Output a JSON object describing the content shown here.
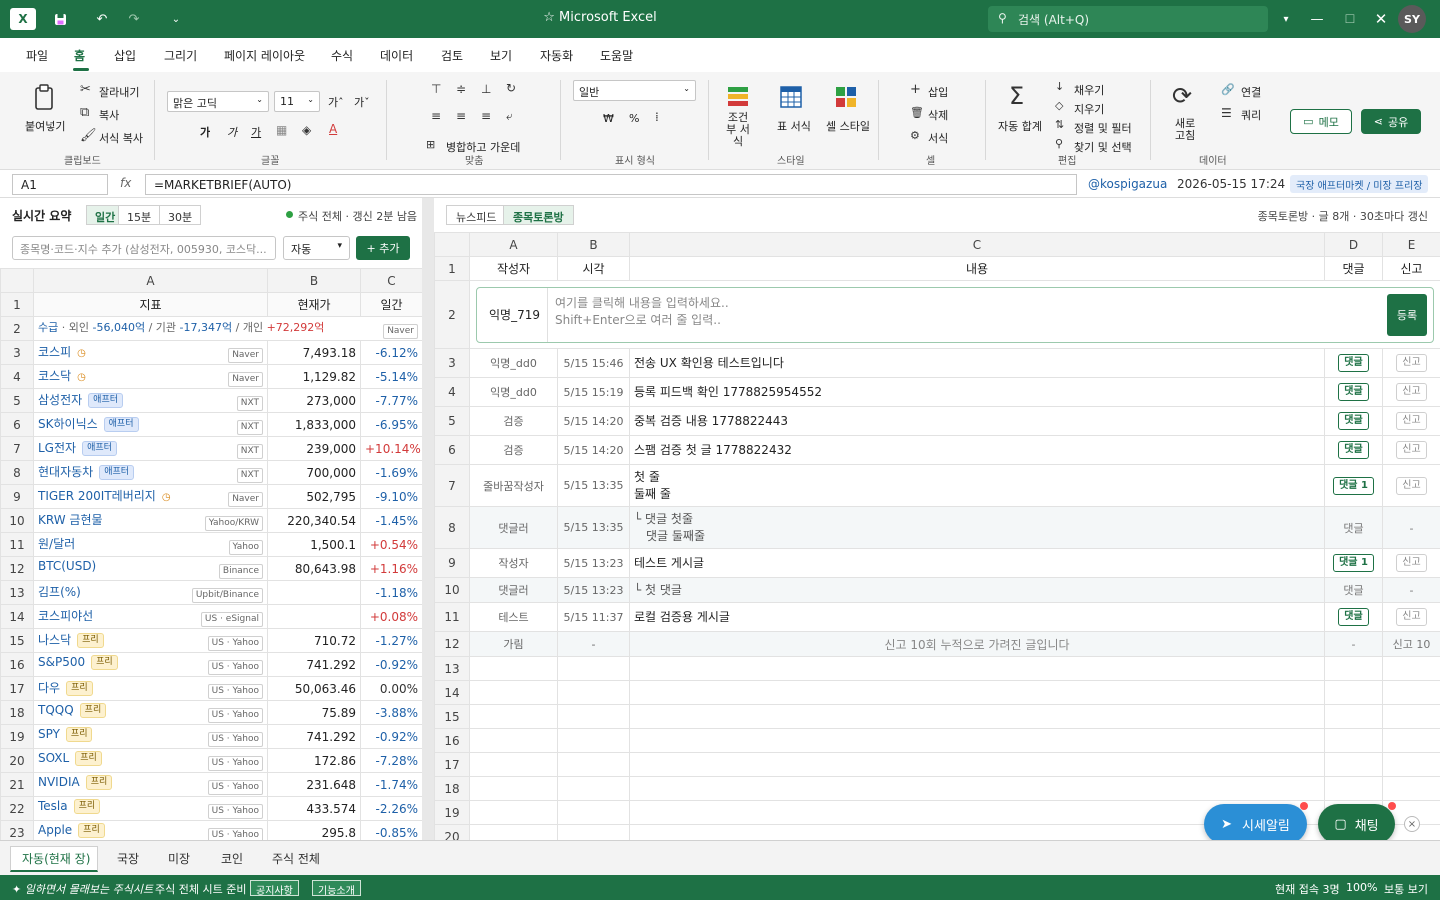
{
  "title_bar": {
    "app_title": "Microsoft Excel",
    "search_placeholder": "검색 (Alt+Q)",
    "avatar_initials": "SY",
    "icons": [
      "excel-logo-icon",
      "save-icon",
      "undo-icon",
      "redo-icon",
      "customize-icon",
      "star-icon",
      "search-icon",
      "ribbon-toggle-icon",
      "minimize-icon",
      "maximize-icon",
      "close-icon"
    ]
  },
  "menu": {
    "items": [
      "파일",
      "홈",
      "삽입",
      "그리기",
      "페이지 레이아웃",
      "수식",
      "데이터",
      "검토",
      "보기",
      "자동화",
      "도움말"
    ],
    "active": "홈"
  },
  "ribbon": {
    "clipboard": {
      "paste": "붙여넣기",
      "cut": "잘라내기",
      "copy": "복사",
      "format_copy": "서식 복사",
      "group": "클립보드"
    },
    "font": {
      "name": "맑은 고딕",
      "size": "11",
      "grow": "가ˆ",
      "shrink": "가ˇ",
      "bold": "가",
      "italic": "가",
      "underline": "가",
      "group": "글꼴"
    },
    "align": {
      "merge": "병합하고 가운데",
      "group": "맞춤"
    },
    "number": {
      "format": "일반",
      "currency": "₩",
      "percent": "%",
      "group": "표시 형식"
    },
    "style": {
      "conditional": "조건부 서식",
      "table": "표 서식",
      "cell_style": "셀 스타일",
      "group": "스타일"
    },
    "cells": {
      "insert": "삽입",
      "delete": "삭제",
      "format": "서식",
      "group": "셀"
    },
    "edit": {
      "sum": "자동 합계",
      "fill": "채우기",
      "clear": "지우기",
      "sort": "정렬 및 필터",
      "find": "찾기 및 선택",
      "group": "편집"
    },
    "data": {
      "refresh": "새로 고침",
      "connect": "연결",
      "query": "쿼리",
      "group": "데이터"
    },
    "memo": "메모",
    "share": "공유"
  },
  "formula_bar": {
    "cell": "A1",
    "fx": "fx",
    "formula": "=MARKETBRIEF(AUTO)",
    "handle": "@kospigazua",
    "datetime": "2026-05-15 17:24",
    "badge": "국장 애프터마켓 / 미장 프리장"
  },
  "left": {
    "title": "실시간 요약",
    "ranges": [
      "일간",
      "15분",
      "30분"
    ],
    "active_range": "일간",
    "status": "주식 전체 · 갱신 2분 남음",
    "search_placeholder": "종목명·코드·지수 추가 (삼성전자, 005930, 코스닥...",
    "mode": "자동",
    "add_button": "+ 추가",
    "col_letters": [
      "A",
      "B",
      "C"
    ],
    "headers": [
      "지표",
      "현재가",
      "일간"
    ],
    "supply": {
      "label": "수급",
      "foreign_label": "· 외인",
      "foreign": "-56,040억",
      "inst_label": "/ 기관",
      "inst": "-17,347억",
      "indiv_label": "/ 개인",
      "indiv": "+72,292억",
      "source": "Naver"
    },
    "rows": [
      {
        "num": "3",
        "name": "코스피",
        "tag": "",
        "clock": true,
        "source": "Naver",
        "price": "7,493.18",
        "change": "-6.12%",
        "dir": "neg"
      },
      {
        "num": "4",
        "name": "코스닥",
        "tag": "",
        "clock": true,
        "source": "Naver",
        "price": "1,129.82",
        "change": "-5.14%",
        "dir": "neg"
      },
      {
        "num": "5",
        "name": "삼성전자",
        "tag": "애프터",
        "clock": false,
        "source": "NXT",
        "price": "273,000",
        "change": "-7.77%",
        "dir": "neg"
      },
      {
        "num": "6",
        "name": "SK하이닉스",
        "tag": "애프터",
        "clock": false,
        "source": "NXT",
        "price": "1,833,000",
        "change": "-6.95%",
        "dir": "neg"
      },
      {
        "num": "7",
        "name": "LG전자",
        "tag": "애프터",
        "clock": false,
        "source": "NXT",
        "price": "239,000",
        "change": "+10.14%",
        "dir": "pos"
      },
      {
        "num": "8",
        "name": "현대자동차",
        "tag": "애프터",
        "clock": false,
        "source": "NXT",
        "price": "700,000",
        "change": "-1.69%",
        "dir": "neg"
      },
      {
        "num": "9",
        "name": "TIGER 200IT레버리지",
        "tag": "",
        "clock": true,
        "source": "Naver",
        "price": "502,795",
        "change": "-9.10%",
        "dir": "neg"
      },
      {
        "num": "10",
        "name": "KRW 금현물",
        "tag": "",
        "clock": false,
        "source": "Yahoo/KRW",
        "price": "220,340.54",
        "change": "-1.45%",
        "dir": "neg"
      },
      {
        "num": "11",
        "name": "원/달러",
        "tag": "",
        "clock": false,
        "source": "Yahoo",
        "price": "1,500.1",
        "change": "+0.54%",
        "dir": "pos"
      },
      {
        "num": "12",
        "name": "BTC(USD)",
        "tag": "",
        "clock": false,
        "source": "Binance",
        "price": "80,643.98",
        "change": "+1.16%",
        "dir": "pos"
      },
      {
        "num": "13",
        "name": "김프(%)",
        "tag": "",
        "clock": false,
        "source": "Upbit/Binance",
        "price": "",
        "change": "-1.18%",
        "dir": "neg"
      },
      {
        "num": "14",
        "name": "코스피야선",
        "tag": "",
        "clock": false,
        "source": "US · eSignal",
        "price": "",
        "change": "+0.08%",
        "dir": "pos"
      },
      {
        "num": "15",
        "name": "나스닥",
        "tag": "프리",
        "clock": false,
        "source": "US · Yahoo",
        "price": "710.72",
        "change": "-1.27%",
        "dir": "neg"
      },
      {
        "num": "16",
        "name": "S&P500",
        "tag": "프리",
        "clock": false,
        "source": "US · Yahoo",
        "price": "741.292",
        "change": "-0.92%",
        "dir": "neg"
      },
      {
        "num": "17",
        "name": "다우",
        "tag": "프리",
        "clock": false,
        "source": "US · Yahoo",
        "price": "50,063.46",
        "change": "0.00%",
        "dir": "zero"
      },
      {
        "num": "18",
        "name": "TQQQ",
        "tag": "프리",
        "clock": false,
        "source": "US · Yahoo",
        "price": "75.89",
        "change": "-3.88%",
        "dir": "neg"
      },
      {
        "num": "19",
        "name": "SPY",
        "tag": "프리",
        "clock": false,
        "source": "US · Yahoo",
        "price": "741.292",
        "change": "-0.92%",
        "dir": "neg"
      },
      {
        "num": "20",
        "name": "SOXL",
        "tag": "프리",
        "clock": false,
        "source": "US · Yahoo",
        "price": "172.86",
        "change": "-7.28%",
        "dir": "neg"
      },
      {
        "num": "21",
        "name": "NVIDIA",
        "tag": "프리",
        "clock": false,
        "source": "US · Yahoo",
        "price": "231.648",
        "change": "-1.74%",
        "dir": "neg"
      },
      {
        "num": "22",
        "name": "Tesla",
        "tag": "프리",
        "clock": false,
        "source": "US · Yahoo",
        "price": "433.574",
        "change": "-2.26%",
        "dir": "neg"
      },
      {
        "num": "23",
        "name": "Apple",
        "tag": "프리",
        "clock": false,
        "source": "US · Yahoo",
        "price": "295.8",
        "change": "-0.85%",
        "dir": "neg"
      }
    ]
  },
  "right": {
    "tabs": [
      "뉴스피드",
      "종목토론방"
    ],
    "active_tab": "종목토론방",
    "info": "종목토론방 · 글 8개 · 30초마다 갱신",
    "col_letters": [
      "A",
      "B",
      "C",
      "D",
      "E"
    ],
    "headers": [
      "작성자",
      "시각",
      "내용",
      "댓글",
      "신고"
    ],
    "composer": {
      "name": "익명_719",
      "placeholder_1": "여기를 클릭해 내용을 입력하세요..",
      "placeholder_2": "Shift+Enter으로 여러 줄 입력..",
      "submit": "등록"
    },
    "posts": [
      {
        "num": "3",
        "author": "익명_dd0",
        "time": "5/15 15:46",
        "content": "전송 UX 확인용 테스트입니다",
        "content2": "",
        "comment": "댓글",
        "comment_style": "btn",
        "report": "신고",
        "report_style": "btn",
        "kind": "post"
      },
      {
        "num": "4",
        "author": "익명_dd0",
        "time": "5/15 15:19",
        "content": "등록 피드백 확인 1778825954552",
        "content2": "",
        "comment": "댓글",
        "comment_style": "btn",
        "report": "신고",
        "report_style": "btn",
        "kind": "post"
      },
      {
        "num": "5",
        "author": "검증",
        "time": "5/15 14:20",
        "content": "중복 검증 내용 1778822443",
        "content2": "",
        "comment": "댓글",
        "comment_style": "btn",
        "report": "신고",
        "report_style": "btn",
        "kind": "post"
      },
      {
        "num": "6",
        "author": "검증",
        "time": "5/15 14:20",
        "content": "스팸 검증 첫 글 1778822432",
        "content2": "",
        "comment": "댓글",
        "comment_style": "btn",
        "report": "신고",
        "report_style": "btn",
        "kind": "post"
      },
      {
        "num": "7",
        "author": "줄바꿈작성자",
        "time": "5/15 13:35",
        "content": "첫 줄",
        "content2": "둘째 줄",
        "comment": "댓글 1",
        "comment_style": "btn",
        "report": "신고",
        "report_style": "btn",
        "kind": "post2"
      },
      {
        "num": "8",
        "author": "댓글러",
        "time": "5/15 13:35",
        "content": "└ 댓글 첫줄",
        "content2": "댓글 둘째줄",
        "comment": "댓글",
        "comment_style": "text",
        "report": "-",
        "report_style": "text",
        "kind": "reply2"
      },
      {
        "num": "9",
        "author": "작성자",
        "time": "5/15 13:23",
        "content": "테스트 게시글",
        "content2": "",
        "comment": "댓글 1",
        "comment_style": "btn",
        "report": "신고",
        "report_style": "btn",
        "kind": "post"
      },
      {
        "num": "10",
        "author": "댓글러",
        "time": "5/15 13:23",
        "content": "└ 첫 댓글",
        "content2": "",
        "comment": "댓글",
        "comment_style": "text",
        "report": "-",
        "report_style": "text",
        "kind": "reply"
      },
      {
        "num": "11",
        "author": "테스트",
        "time": "5/15 11:37",
        "content": "로컬 검증용 게시글",
        "content2": "",
        "comment": "댓글",
        "comment_style": "btn",
        "report": "신고",
        "report_style": "btn",
        "kind": "post"
      },
      {
        "num": "12",
        "author": "가림",
        "time": "-",
        "content": "신고 10회 누적으로 가려진 글입니다",
        "content2": "",
        "comment": "-",
        "comment_style": "text",
        "report": "신고 10",
        "report_style": "text",
        "kind": "hidden"
      }
    ],
    "empty_rows": [
      "13",
      "14",
      "15",
      "16",
      "17",
      "18",
      "19",
      "20"
    ]
  },
  "float": {
    "alert": "시세알림",
    "chat": "채팅",
    "close": "×"
  },
  "sheet_tabs": {
    "items": [
      "자동(현재 장)",
      "국장",
      "미장",
      "코인",
      "주식 전체"
    ],
    "active": "자동(현재 장)"
  },
  "status_bar": {
    "slogan": "✦ 일하면서 몰래보는 주식시트",
    "ready": "주식 전체 시트 준비",
    "notice": "공지사항",
    "features": "기능소개",
    "users": "현재 접속 3명",
    "zoom": "100%",
    "view": "보통 보기"
  },
  "colors": {
    "brand": "#1e7145",
    "negative": "#1e60a8",
    "positive": "#d23a3a",
    "alert_btn": "#2b8fd6",
    "chat_btn": "#1e7145"
  }
}
